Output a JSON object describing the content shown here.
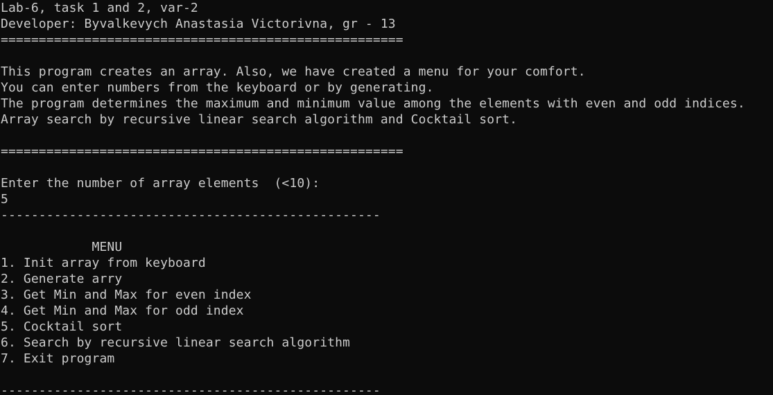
{
  "header": {
    "title": "Lab-6, task 1 and 2, var-2",
    "developer": "Developer: Byvalkevych Anastasia Victorivna, gr - 13",
    "separator": "=====================================================",
    "separator_after_desc": "====================================================="
  },
  "description": {
    "line1": "This program creates an array. Also, we have created a menu for your comfort.",
    "line2": "You can enter numbers from the keyboard or by generating.",
    "line3": "The program determines the maximum and minimum value among the elements with even and odd indices.",
    "line4": "Array search by recursive linear search algorithm and Cocktail sort."
  },
  "prompt": {
    "text": "Enter the number of array elements  (<10):",
    "input_value": "5",
    "divider": "--------------------------------------------------"
  },
  "menu": {
    "title": "            MENU",
    "items": [
      {
        "label": "1. Init array from keyboard"
      },
      {
        "label": "2. Generate arry"
      },
      {
        "label": "3. Get Min and Max for even index"
      },
      {
        "label": "4. Get Min and Max for odd index"
      },
      {
        "label": "5. Cocktail sort"
      },
      {
        "label": "6. Search by recursive linear search algorithm"
      },
      {
        "label": "7. Exit program"
      }
    ],
    "bottom_divider": "--------------------------------------------------"
  },
  "colors": {
    "background": "#0c0c0c",
    "text": "#cccccc"
  }
}
